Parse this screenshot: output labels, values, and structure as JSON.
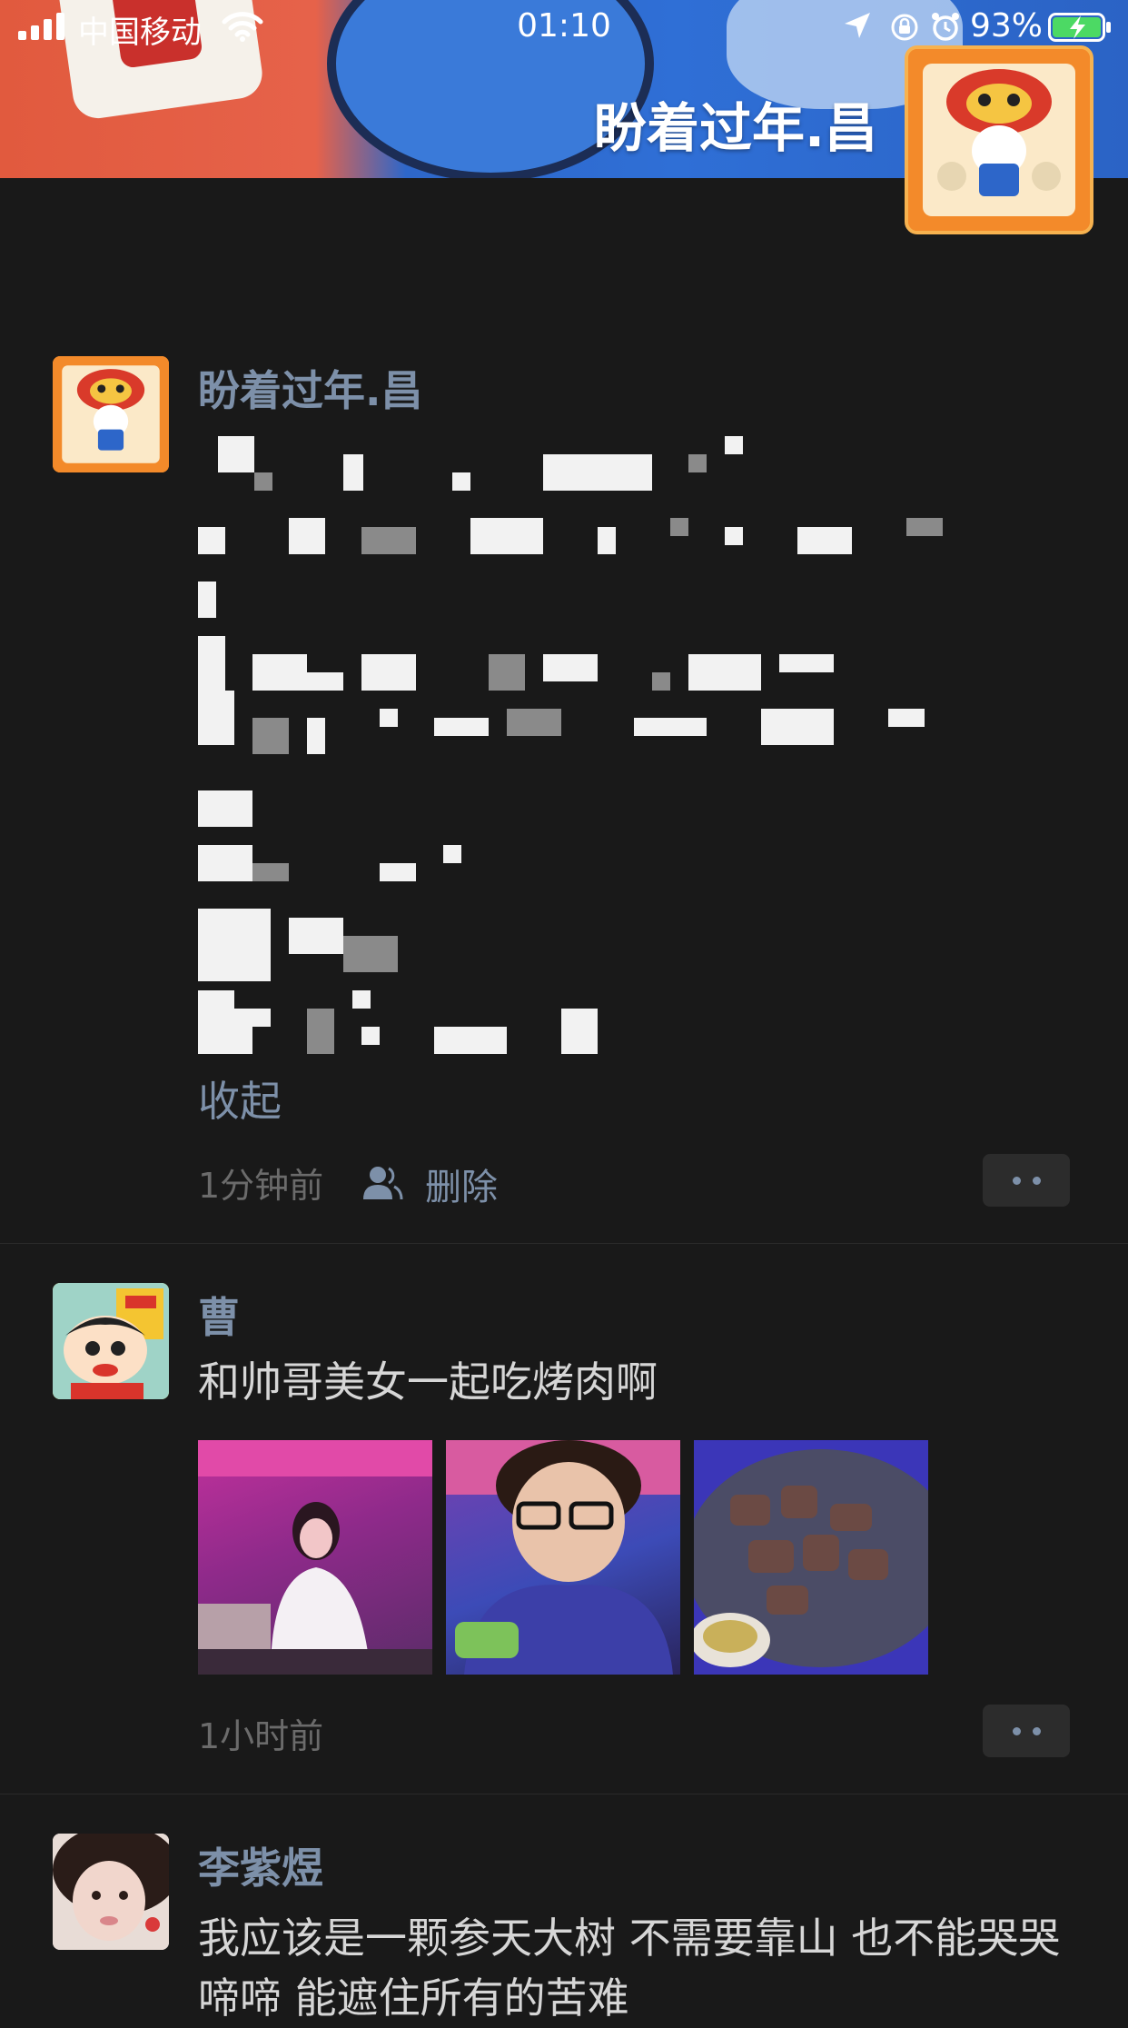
{
  "status_bar": {
    "carrier": "中国移动",
    "time": "01:10",
    "battery_percent": "93%",
    "battery_level": 0.93
  },
  "cover": {
    "user_name": "盼着过年.昌"
  },
  "posts": [
    {
      "user": "盼着过年.昌",
      "collapse_label": "收起",
      "time": "1分钟前",
      "delete_label": "删除"
    },
    {
      "user": "曹",
      "text": "和帅哥美女一起吃烤肉啊",
      "time": "1小时前"
    },
    {
      "user": "李紫煜",
      "text": "我应该是一颗参天大树 不需要靠山 也不能哭哭啼啼 能遮住所有的苦难"
    }
  ],
  "colors": {
    "background": "#191919",
    "link": "#7d90a9",
    "meta": "#6b6b6b"
  }
}
